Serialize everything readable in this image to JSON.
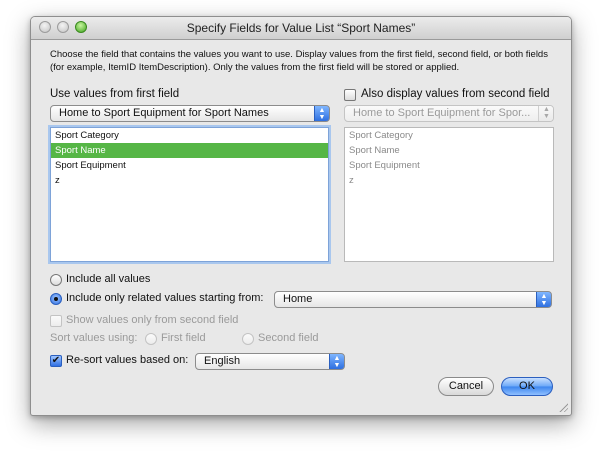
{
  "window": {
    "title": "Specify Fields for Value List “Sport Names”"
  },
  "description": "Choose the field that contains the values you want to use.  Display values from the first field, second field, or both fields (for example, ItemID ItemDescription). Only the values from the first field will be stored or applied.",
  "first_field": {
    "label": "Use values from first field",
    "table_popup": "Home to Sport Equipment for Sport Names",
    "fields": [
      "Sport Category",
      "Sport Name",
      "Sport Equipment",
      "z"
    ],
    "selected_index": 1
  },
  "second_field": {
    "checkbox_label": "Also display values from second field",
    "checked": false,
    "table_popup": "Home to Sport Equipment for Spor...",
    "fields": [
      "Sport Category",
      "Sport Name",
      "Sport Equipment",
      "z"
    ]
  },
  "include": {
    "all_label": "Include all values",
    "related_label": "Include only related values starting from:",
    "related_popup": "Home",
    "selected": "related"
  },
  "show_second_only": {
    "label": "Show values only from second field",
    "checked": false
  },
  "sort_using": {
    "label": "Sort values using:",
    "first_label": "First field",
    "second_label": "Second field"
  },
  "resort": {
    "label": "Re-sort values based on:",
    "checked": true,
    "popup": "English"
  },
  "buttons": {
    "cancel": "Cancel",
    "ok": "OK"
  },
  "icons": {
    "popup_arrows": "▲▼",
    "checkmark": "✔"
  },
  "colors": {
    "selection": "#56b646",
    "accent": "#2f6fe2"
  }
}
